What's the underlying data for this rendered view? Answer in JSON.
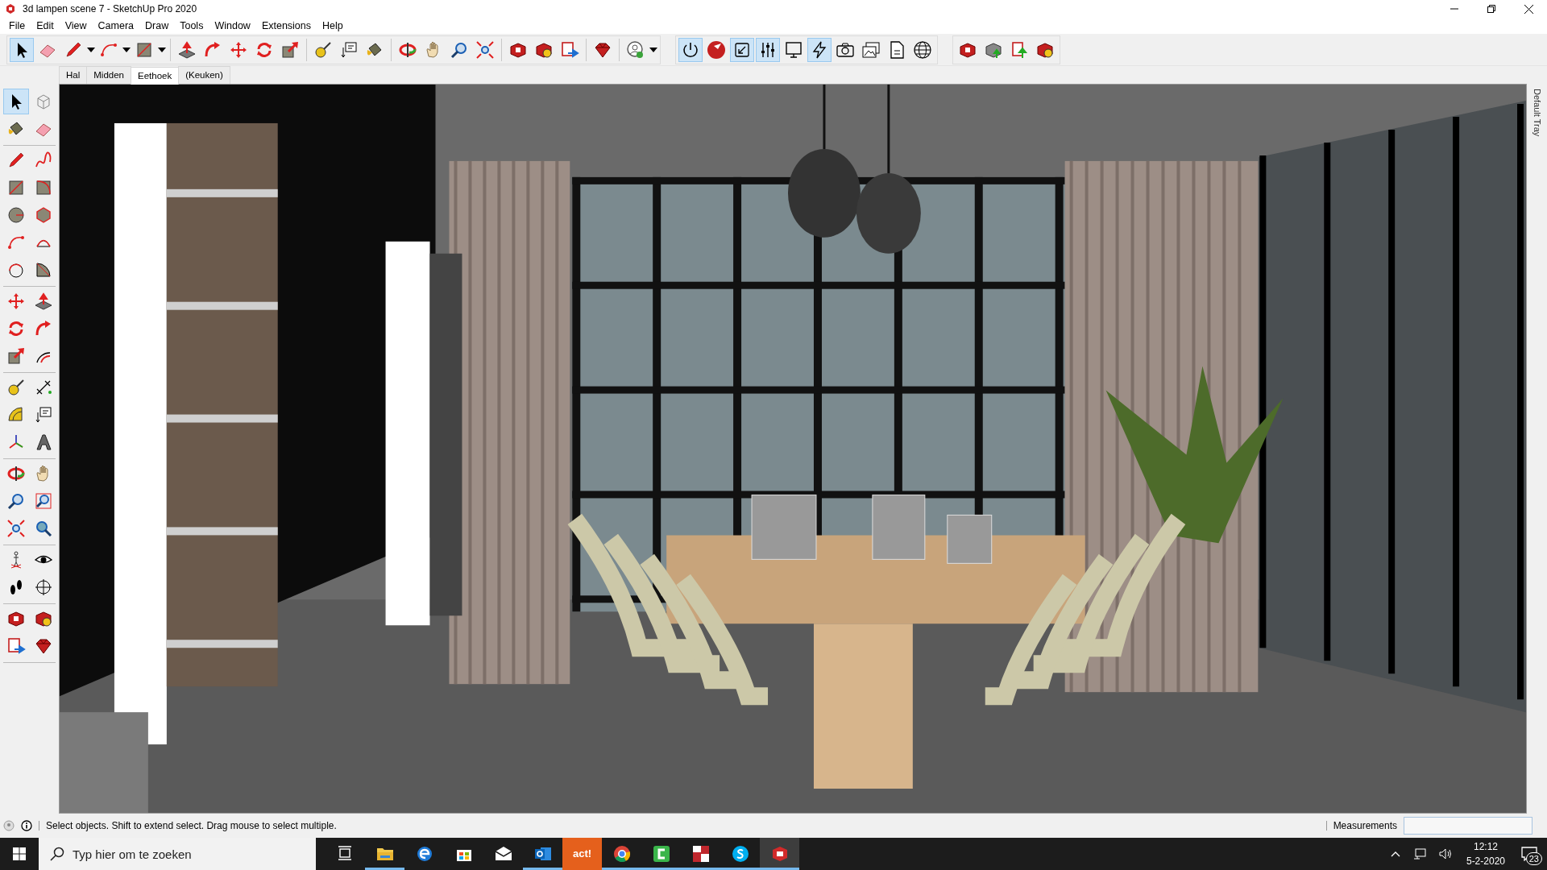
{
  "window": {
    "title": "3d lampen scene 7 - SketchUp Pro 2020"
  },
  "menu": [
    "File",
    "Edit",
    "View",
    "Camera",
    "Draw",
    "Tools",
    "Window",
    "Extensions",
    "Help"
  ],
  "toolbars": [
    [
      {
        "kind": "select",
        "selected": true
      },
      {
        "kind": "eraser",
        "selected": false
      },
      {
        "kind": "pencil",
        "selected": false,
        "dropdown": true
      },
      {
        "kind": "arc",
        "selected": false,
        "dropdown": true
      },
      {
        "kind": "rect",
        "selected": false,
        "dropdown": true
      },
      {
        "kind": "separator"
      },
      {
        "kind": "pushpull",
        "selected": false
      },
      {
        "kind": "followme",
        "selected": false
      },
      {
        "kind": "move",
        "selected": false
      },
      {
        "kind": "rotate",
        "selected": false
      },
      {
        "kind": "scale",
        "selected": false
      },
      {
        "kind": "separator"
      },
      {
        "kind": "tape",
        "selected": false
      },
      {
        "kind": "textbox",
        "selected": false
      },
      {
        "kind": "paint",
        "selected": false
      },
      {
        "kind": "separator"
      },
      {
        "kind": "orbit",
        "selected": false
      },
      {
        "kind": "pan",
        "selected": false
      },
      {
        "kind": "zoom",
        "selected": false
      },
      {
        "kind": "extents",
        "selected": false
      },
      {
        "kind": "separator"
      },
      {
        "kind": "warehouse",
        "selected": false
      },
      {
        "kind": "warehouse2",
        "selected": false
      },
      {
        "kind": "layout",
        "selected": false
      },
      {
        "kind": "separator"
      },
      {
        "kind": "gem",
        "selected": false
      },
      {
        "kind": "separator"
      },
      {
        "kind": "user",
        "selected": false,
        "dropdown": true
      }
    ],
    [
      {
        "kind": "power",
        "selected": true
      },
      {
        "kind": "logo",
        "selected": false
      },
      {
        "kind": "resize",
        "selected": true
      },
      {
        "kind": "sliders",
        "selected": true
      },
      {
        "kind": "frame",
        "selected": false
      },
      {
        "kind": "bolt",
        "selected": true
      },
      {
        "kind": "camera",
        "selected": false
      },
      {
        "kind": "images",
        "selected": false
      },
      {
        "kind": "file",
        "selected": false
      },
      {
        "kind": "globe",
        "selected": false
      }
    ],
    [
      {
        "kind": "warehouse",
        "selected": false
      },
      {
        "kind": "upload",
        "selected": false
      },
      {
        "kind": "upload2",
        "selected": false
      },
      {
        "kind": "warehouse2",
        "selected": false
      }
    ]
  ],
  "scene_tabs": [
    {
      "label": "Hal",
      "selected": false
    },
    {
      "label": "Midden",
      "selected": false
    },
    {
      "label": "Eethoek",
      "selected": true
    },
    {
      "label": "(Keuken)",
      "selected": false
    }
  ],
  "side_toolbar": [
    [
      {
        "kind": "select",
        "selected": true
      },
      {
        "kind": "component",
        "selected": false
      },
      {
        "kind": "paint",
        "selected": false
      },
      {
        "kind": "eraser",
        "selected": false
      }
    ],
    [
      {
        "kind": "pencil",
        "selected": false
      },
      {
        "kind": "freehand",
        "selected": false
      },
      {
        "kind": "rect",
        "selected": false
      },
      {
        "kind": "rotrect",
        "selected": false
      },
      {
        "kind": "circle",
        "selected": false
      },
      {
        "kind": "polygon",
        "selected": false
      },
      {
        "kind": "arc",
        "selected": false
      },
      {
        "kind": "arc2",
        "selected": false
      },
      {
        "kind": "arc3",
        "selected": false
      },
      {
        "kind": "pie",
        "selected": false
      }
    ],
    [
      {
        "kind": "move",
        "selected": false
      },
      {
        "kind": "pushpull",
        "selected": false
      },
      {
        "kind": "rotate",
        "selected": false
      },
      {
        "kind": "followme",
        "selected": false
      },
      {
        "kind": "scale",
        "selected": false
      },
      {
        "kind": "offset",
        "selected": false
      }
    ],
    [
      {
        "kind": "tape",
        "selected": false
      },
      {
        "kind": "dimension",
        "selected": false
      },
      {
        "kind": "protractor",
        "selected": false
      },
      {
        "kind": "textbox",
        "selected": false
      },
      {
        "kind": "axes",
        "selected": false
      },
      {
        "kind": "text3d",
        "selected": false
      }
    ],
    [
      {
        "kind": "orbit",
        "selected": false
      },
      {
        "kind": "pan",
        "selected": false
      },
      {
        "kind": "zoom",
        "selected": false
      },
      {
        "kind": "zoomwin",
        "selected": false
      },
      {
        "kind": "extents",
        "selected": false
      },
      {
        "kind": "previous",
        "selected": false
      }
    ],
    [
      {
        "kind": "person",
        "selected": false
      },
      {
        "kind": "eye",
        "selected": false
      },
      {
        "kind": "feet",
        "selected": false
      },
      {
        "kind": "section",
        "selected": false
      }
    ],
    [
      {
        "kind": "warehouse",
        "selected": false
      },
      {
        "kind": "warehouse2",
        "selected": false
      },
      {
        "kind": "layout",
        "selected": false
      },
      {
        "kind": "gem",
        "selected": false
      }
    ]
  ],
  "tray": {
    "label": "Default Tray"
  },
  "status_bar": {
    "message": "Select objects. Shift to extend select. Drag mouse to select multiple.",
    "measurements_label": "Measurements"
  },
  "taskbar": {
    "search_placeholder": "Typ hier om te zoeken",
    "apps": [
      {
        "kind": "taskview",
        "active": false
      },
      {
        "kind": "folder",
        "active": true
      },
      {
        "kind": "edge",
        "active": false
      },
      {
        "kind": "store",
        "active": false
      },
      {
        "kind": "mail",
        "active": false
      },
      {
        "kind": "outlook",
        "active": true
      },
      {
        "kind": "act",
        "label": "act!",
        "active": false
      },
      {
        "kind": "chrome",
        "active": true
      },
      {
        "kind": "camtasia",
        "active": true
      },
      {
        "kind": "redapp",
        "active": true
      },
      {
        "kind": "skype",
        "active": true
      },
      {
        "kind": "sketchup",
        "active": true
      }
    ],
    "time": "12:12",
    "date": "5-2-2020",
    "notifications": "23"
  }
}
